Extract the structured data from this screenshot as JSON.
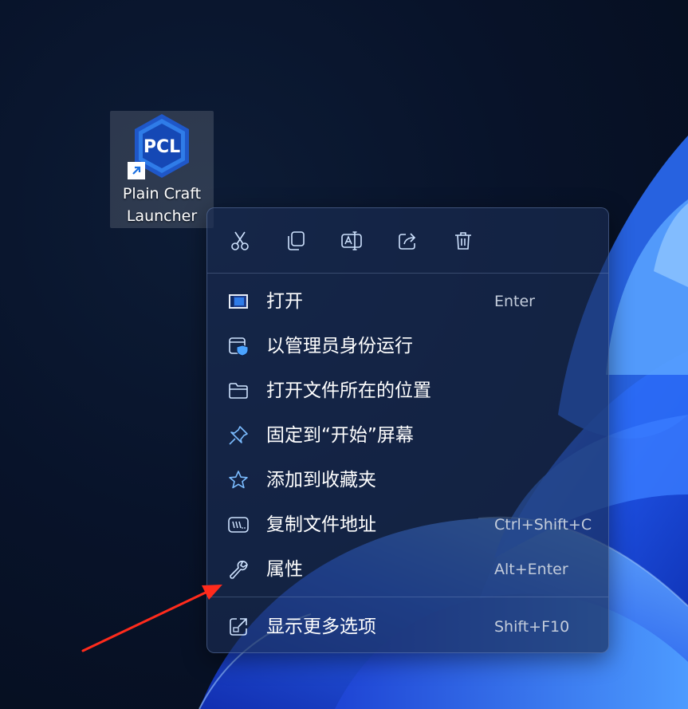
{
  "desktop": {
    "shortcut": {
      "logo_text": "PCL",
      "label_line1": "Plain Craft",
      "label_line2": "Launcher"
    }
  },
  "context_menu": {
    "toolbar": [
      {
        "name": "cut-icon"
      },
      {
        "name": "copy-icon"
      },
      {
        "name": "rename-icon"
      },
      {
        "name": "share-icon"
      },
      {
        "name": "delete-icon"
      }
    ],
    "items": [
      {
        "icon": "open-app-icon",
        "label": "打开",
        "shortcut": "Enter"
      },
      {
        "icon": "shield-run-icon",
        "label": "以管理员身份运行",
        "shortcut": ""
      },
      {
        "icon": "folder-icon",
        "label": "打开文件所在的位置",
        "shortcut": ""
      },
      {
        "icon": "pin-icon",
        "label": "固定到“开始”屏幕",
        "shortcut": ""
      },
      {
        "icon": "star-icon",
        "label": "添加到收藏夹",
        "shortcut": ""
      },
      {
        "icon": "copy-path-icon",
        "label": "复制文件地址",
        "shortcut": "Ctrl+Shift+C"
      },
      {
        "icon": "wrench-icon",
        "label": "属性",
        "shortcut": "Alt+Enter"
      },
      {
        "icon": "more-options-icon",
        "label": "显示更多选项",
        "shortcut": "Shift+F10"
      }
    ]
  },
  "colors": {
    "accent": "#4aa3ff",
    "annotation_arrow": "#ff2b1c"
  }
}
